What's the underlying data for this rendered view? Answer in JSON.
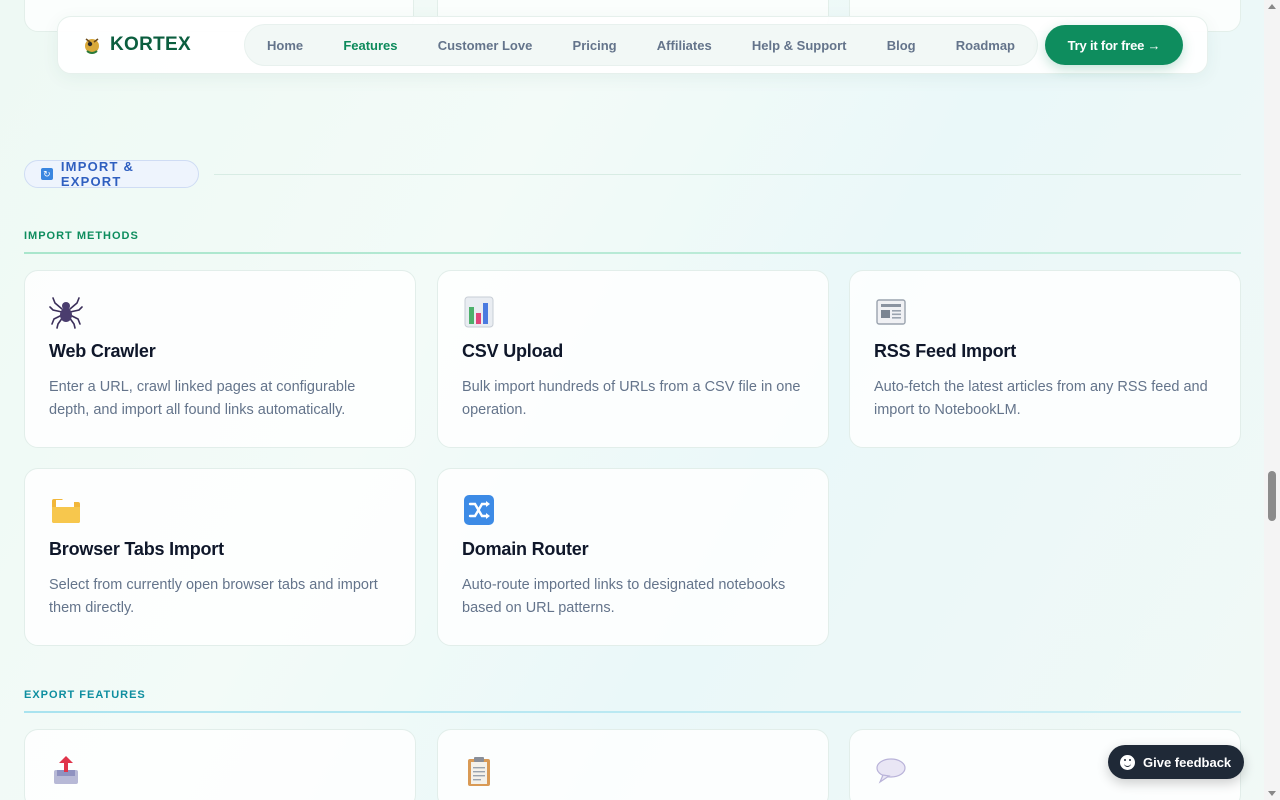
{
  "nav": {
    "brand": "KORTEX",
    "links": [
      "Home",
      "Features",
      "Customer Love",
      "Pricing",
      "Affiliates",
      "Help & Support",
      "Blog",
      "Roadmap"
    ],
    "active_link": "Features",
    "cta": "Try it for free →"
  },
  "section": {
    "badge": "IMPORT & EXPORT"
  },
  "import": {
    "heading": "IMPORT METHODS",
    "cards": [
      {
        "icon": "spider-icon",
        "title": "Web Crawler",
        "desc": "Enter a URL, crawl linked pages at configurable depth, and import all found links automatically."
      },
      {
        "icon": "bar-chart-icon",
        "title": "CSV Upload",
        "desc": "Bulk import hundreds of URLs from a CSV file in one operation."
      },
      {
        "icon": "newspaper-icon",
        "title": "RSS Feed Import",
        "desc": "Auto-fetch the latest articles from any RSS feed and import to NotebookLM."
      },
      {
        "icon": "folder-icon",
        "title": "Browser Tabs Import",
        "desc": "Select from currently open browser tabs and import them directly."
      },
      {
        "icon": "shuffle-icon",
        "title": "Domain Router",
        "desc": "Auto-route imported links to designated notebooks based on URL patterns."
      }
    ]
  },
  "export": {
    "heading": "EXPORT FEATURES",
    "cards": [
      {
        "icon": "outbox-icon"
      },
      {
        "icon": "clipboard-icon"
      },
      {
        "icon": "speech-bubble-icon"
      }
    ]
  },
  "feedback": {
    "label": "Give feedback"
  }
}
